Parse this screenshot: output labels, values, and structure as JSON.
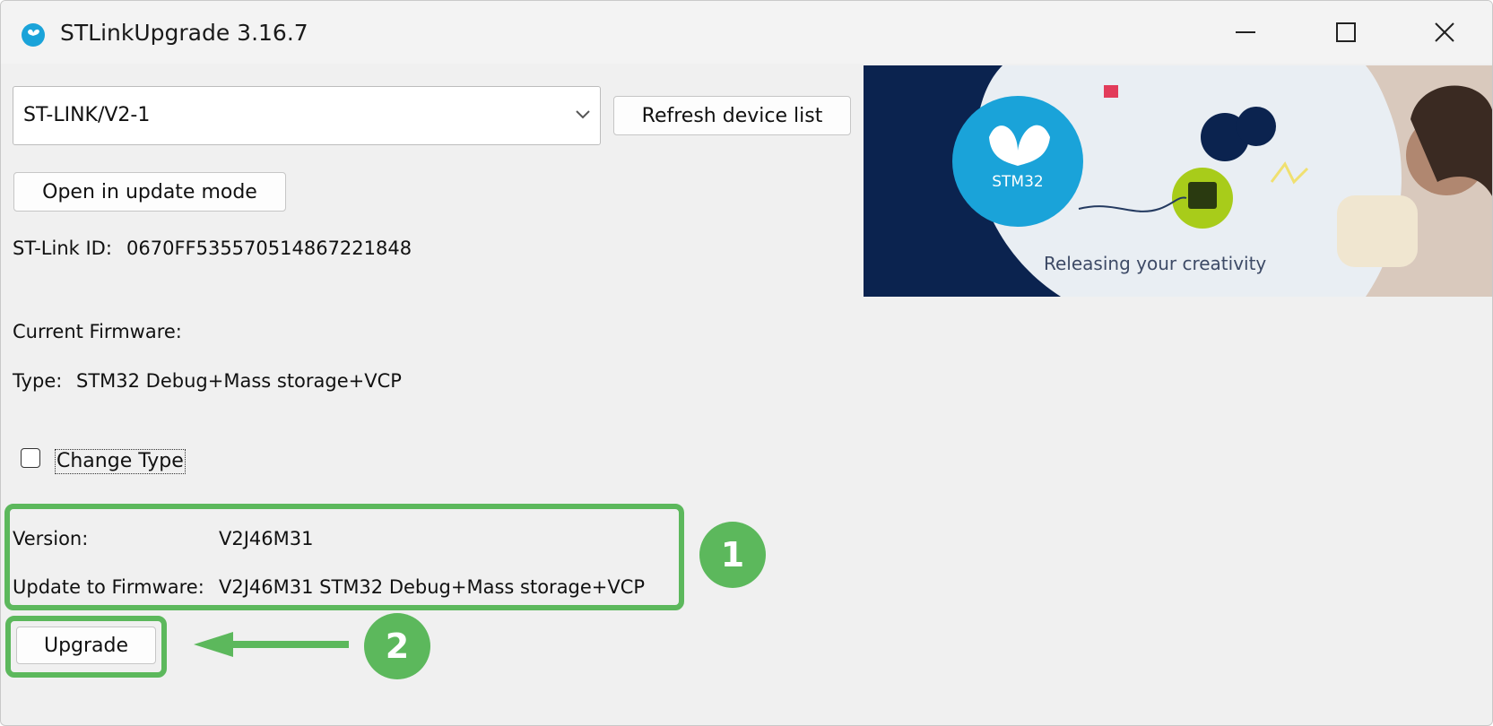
{
  "window": {
    "title": "STLinkUpgrade 3.16.7"
  },
  "device_select": {
    "value": "ST-LINK/V2-1"
  },
  "buttons": {
    "refresh": "Refresh device list",
    "open_update_mode": "Open in update mode",
    "upgrade": "Upgrade"
  },
  "info": {
    "stlink_id_label": "ST-Link ID:",
    "stlink_id_value": "0670FF535570514867221848",
    "current_firmware_label": "Current Firmware:",
    "type_label": "Type:",
    "type_value": "STM32 Debug+Mass storage+VCP"
  },
  "change_type": {
    "label": "Change Type",
    "checked": false
  },
  "update": {
    "version_label": "Version:",
    "version_value": "V2J46M31",
    "update_to_label": "Update to Firmware:",
    "update_to_value": "V2J46M31 STM32 Debug+Mass storage+VCP"
  },
  "annotations": {
    "badge1": "1",
    "badge2": "2",
    "color": "#5cb85c"
  },
  "banner": {
    "logo_text": "STM32",
    "tagline": "Releasing your creativity"
  },
  "icons": [
    "app-icon",
    "minimize-icon",
    "maximize-icon",
    "close-icon",
    "chevron-down-icon",
    "left-arrow-icon"
  ]
}
